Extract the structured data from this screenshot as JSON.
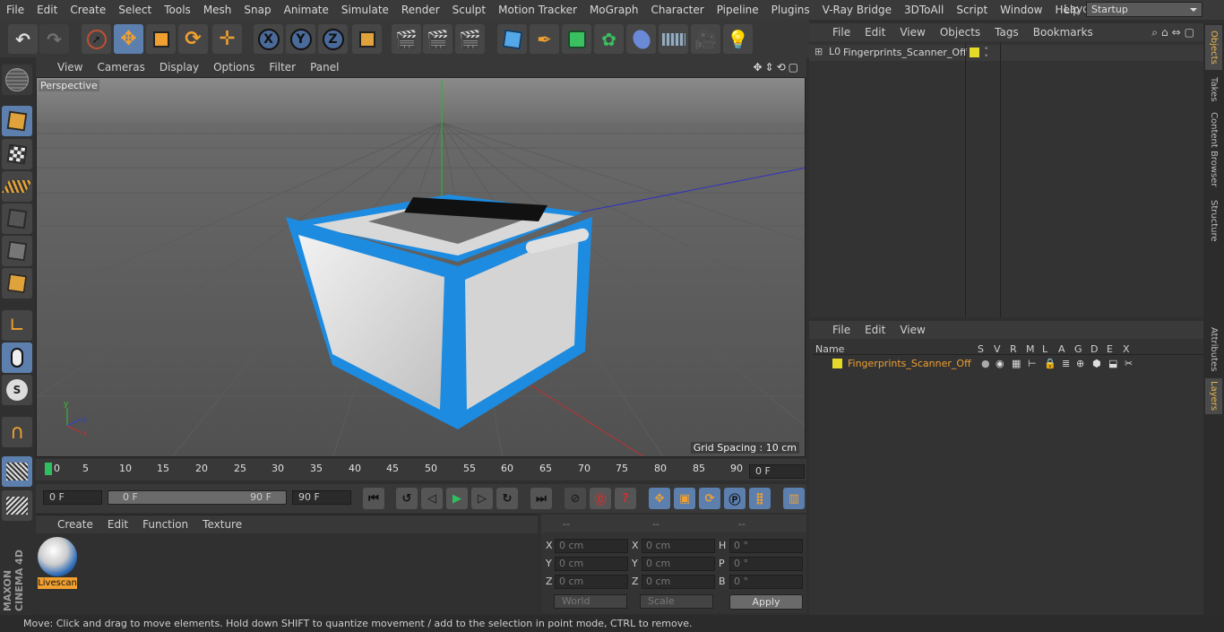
{
  "menubar": {
    "items": [
      "File",
      "Edit",
      "Create",
      "Select",
      "Tools",
      "Mesh",
      "Snap",
      "Animate",
      "Simulate",
      "Render",
      "Sculpt",
      "Motion Tracker",
      "MoGraph",
      "Character",
      "Pipeline",
      "Plugins",
      "V-Ray Bridge",
      "3DToAll",
      "Script",
      "Window",
      "Help"
    ],
    "layout_label": "Layout:",
    "layout_value": "Startup"
  },
  "viewport": {
    "menu": [
      "View",
      "Cameras",
      "Display",
      "Options",
      "Filter",
      "Panel"
    ],
    "camera_label": "Perspective",
    "grid_spacing": "Grid Spacing : 10 cm"
  },
  "timeline": {
    "ticks": [
      "0",
      "5",
      "10",
      "15",
      "20",
      "25",
      "30",
      "35",
      "40",
      "45",
      "50",
      "55",
      "60",
      "65",
      "70",
      "75",
      "80",
      "85",
      "90"
    ],
    "current_frame": "0 F",
    "start_frame": "0 F",
    "range_start": "0 F",
    "range_end": "90 F",
    "end_frame": "90 F"
  },
  "materials": {
    "menu": [
      "Create",
      "Edit",
      "Function",
      "Texture"
    ],
    "items": [
      {
        "name": "Livescan"
      }
    ]
  },
  "coordinates": {
    "headers": [
      "--",
      "--",
      "--"
    ],
    "rows": [
      {
        "l1": "X",
        "v1": "0 cm",
        "l2": "X",
        "v2": "0 cm",
        "l3": "H",
        "v3": "0 °"
      },
      {
        "l1": "Y",
        "v1": "0 cm",
        "l2": "Y",
        "v2": "0 cm",
        "l3": "P",
        "v3": "0 °"
      },
      {
        "l1": "Z",
        "v1": "0 cm",
        "l2": "Z",
        "v2": "0 cm",
        "l3": "B",
        "v3": "0 °"
      }
    ],
    "mode1": "World",
    "mode2": "Scale",
    "apply": "Apply"
  },
  "objects": {
    "menu": [
      "File",
      "Edit",
      "View",
      "Objects",
      "Tags",
      "Bookmarks"
    ],
    "items": [
      {
        "name": "Fingerprints_Scanner_Off",
        "color": "#e5d92a"
      }
    ]
  },
  "layers": {
    "menu": [
      "File",
      "Edit",
      "View"
    ],
    "columns": [
      "Name",
      "S",
      "V",
      "R",
      "M",
      "L",
      "A",
      "G",
      "D",
      "E",
      "X"
    ],
    "items": [
      {
        "name": "Fingerprints_Scanner_Off",
        "color": "#e5d92a"
      }
    ]
  },
  "side_tabs": [
    "Objects",
    "Takes",
    "Content Browser",
    "Structure",
    "Attributes",
    "Layers"
  ],
  "status": "Move: Click and drag to move elements. Hold down SHIFT to quantize movement / add to the selection in point mode, CTRL to remove.",
  "brand": "MAXON CINEMA 4D",
  "colors": {
    "accent": "#5c7fae",
    "selected_text": "#f0a030",
    "object_tag": "#e5d92a",
    "model_blue": "#1d8be0"
  }
}
